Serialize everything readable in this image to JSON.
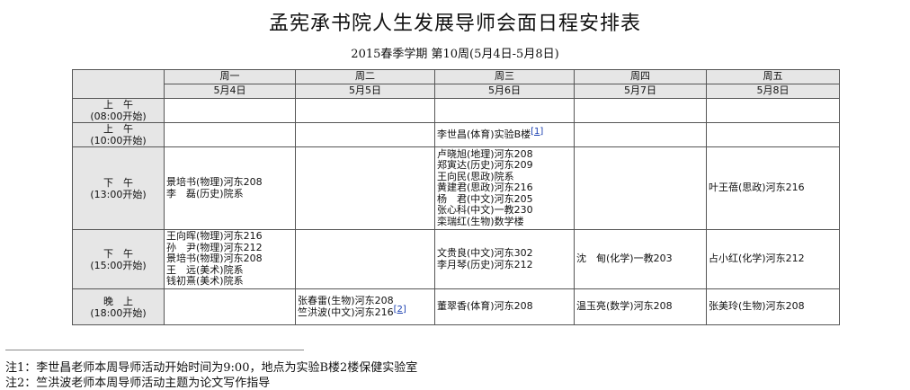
{
  "title": "孟宪承书院人生发展导师会面日程安排表",
  "subtitle": "2015春季学期 第10周(5月4日-5月8日)",
  "days": [
    {
      "name": "周一",
      "date": "5月4日"
    },
    {
      "name": "周二",
      "date": "5月5日"
    },
    {
      "name": "周三",
      "date": "5月6日"
    },
    {
      "name": "周四",
      "date": "5月7日"
    },
    {
      "name": "周五",
      "date": "5月8日"
    }
  ],
  "slots": [
    {
      "label": "上　午",
      "time": "(08:00开始)",
      "cells": [
        [],
        [],
        [],
        [],
        []
      ]
    },
    {
      "label": "上　午",
      "time": "(10:00开始)",
      "cells": [
        [],
        [],
        [
          "李世昌(体育)实验B楼"
        ],
        [],
        []
      ],
      "ref": {
        "day": 2,
        "text": "[1]"
      }
    },
    {
      "label": "下　午",
      "time": "(13:00开始)",
      "cells": [
        [
          "景培书(物理)河东208",
          "李　磊(历史)院系"
        ],
        [],
        [
          "卢晓旭(地理)河东208",
          "郑寅达(历史)河东209",
          "王向民(思政)院系",
          "黄建君(思政)河东216",
          "杨　君(中文)河东205",
          "张心科(中文)一教230",
          "栾瑞红(生物)数学楼"
        ],
        [],
        [
          "叶王蓓(思政)河东216"
        ]
      ]
    },
    {
      "label": "下　午",
      "time": "(15:00开始)",
      "cells": [
        [
          "王向晖(物理)河东216",
          "孙　尹(物理)河东212",
          "景培书(物理)河东208",
          "王　远(美术)院系",
          "钱初熹(美术)院系"
        ],
        [],
        [
          "文贵良(中文)河东302",
          "李月琴(历史)河东212"
        ],
        [
          "沈　甸(化学)一教203"
        ],
        [
          "占小红(化学)河东212"
        ]
      ]
    },
    {
      "label": "晚　上",
      "time": "(18:00开始)",
      "cells": [
        [],
        [
          "张春雷(生物)河东208",
          "竺洪波(中文)河东216"
        ],
        [
          "董翠香(体育)河东208"
        ],
        [
          "温玉亮(数学)河东208"
        ],
        [
          "张美玲(生物)河东208"
        ]
      ],
      "ref": {
        "day": 1,
        "text": "[2]"
      }
    }
  ],
  "notes": [
    "注1：李世昌老师本周导师活动开始时间为9:00，地点为实验B楼2楼保健实验室",
    "注2：竺洪波老师本周导师活动主题为论文写作指导"
  ]
}
